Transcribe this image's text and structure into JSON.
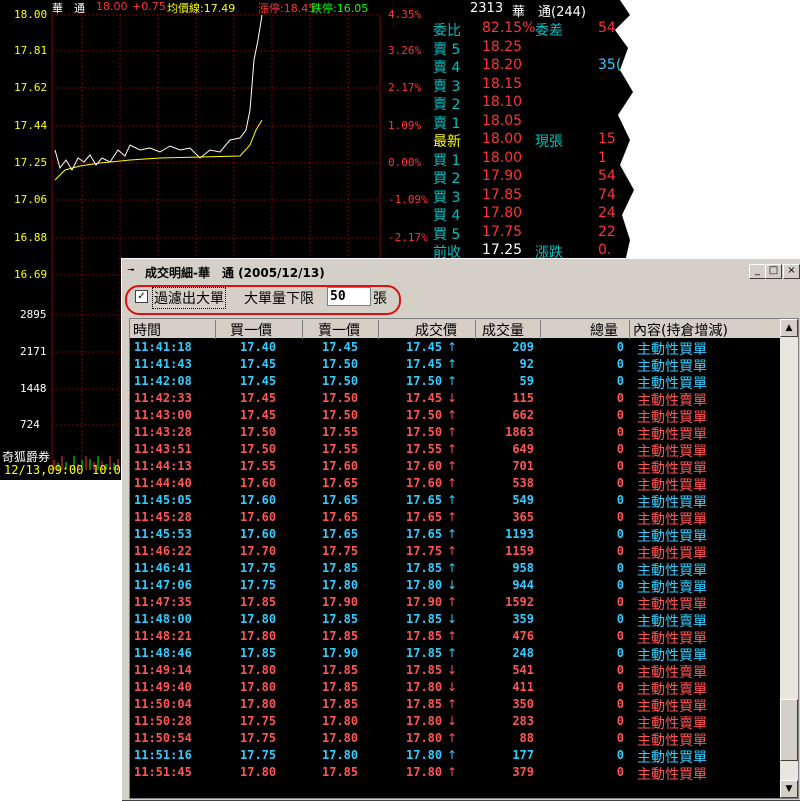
{
  "chart": {
    "header": {
      "name": "華　通",
      "price": "18.00",
      "change": "+0.75",
      "avg": "均價線:17.49",
      "limit_up": "漲停:18.45",
      "limit_down": "跌停:16.05"
    },
    "price_axis": [
      "18.00",
      "17.81",
      "17.62",
      "17.44",
      "17.25",
      "17.06",
      "16.88",
      "16.69"
    ],
    "pct_axis": [
      "4.35%",
      "3.26%",
      "2.17%",
      "1.09%",
      "0.00%",
      "-1.09%",
      "-2.17%"
    ],
    "volume_axis": [
      "2895",
      "2171",
      "1448",
      "724"
    ],
    "broker": "奇狐爵券",
    "time_start": "12/13,09:00",
    "time_next": "10:0"
  },
  "quote": {
    "code": "2313",
    "name": "華　通(244)",
    "rows": [
      {
        "label": "委比",
        "value": "82.15%",
        "label2": "委差",
        "value2": "54"
      },
      {
        "label": "賣 5",
        "value": "18.25",
        "value2": ""
      },
      {
        "label": "賣 4",
        "value": "18.20",
        "value2": "35("
      },
      {
        "label": "賣 3",
        "value": "18.15",
        "value2": ""
      },
      {
        "label": "賣 2",
        "value": "18.10",
        "value2": ""
      },
      {
        "label": "賣 1",
        "value": "18.05",
        "value2": ""
      },
      {
        "label": "最新",
        "value": "18.00",
        "label2": "現張",
        "value2": "15"
      },
      {
        "label": "買 1",
        "value": "18.00",
        "value2": "1"
      },
      {
        "label": "買 2",
        "value": "17.90",
        "value2": "54"
      },
      {
        "label": "買 3",
        "value": "17.85",
        "value2": "74"
      },
      {
        "label": "買 4",
        "value": "17.80",
        "value2": "24"
      },
      {
        "label": "買 5",
        "value": "17.75",
        "value2": "22"
      },
      {
        "label": "前收",
        "value": "17.25",
        "label2": "漲跌",
        "value2": "0."
      }
    ]
  },
  "window": {
    "title": "成交明細-華　通 (2005/12/13)",
    "filter_checked": "✓",
    "filter_label": "過濾出大單",
    "min_label": "大單量下限",
    "min_value": "50",
    "unit": "張",
    "columns": [
      "時間",
      "買一價",
      "賣一價",
      "成交價",
      "成交量",
      "總量",
      "內容(持倉增減)"
    ],
    "rows": [
      {
        "time": "11:41:18",
        "bid": "17.40",
        "ask": "17.45",
        "price": "17.45",
        "dir": "↑",
        "vol": "209",
        "total": "0",
        "note": "主動性買單",
        "side": "buy"
      },
      {
        "time": "11:41:43",
        "bid": "17.45",
        "ask": "17.50",
        "price": "17.45",
        "dir": "↑",
        "vol": "92",
        "total": "0",
        "note": "主動性買單",
        "side": "buy"
      },
      {
        "time": "11:42:08",
        "bid": "17.45",
        "ask": "17.50",
        "price": "17.50",
        "dir": "↑",
        "vol": "59",
        "total": "0",
        "note": "主動性買單",
        "side": "buy"
      },
      {
        "time": "11:42:33",
        "bid": "17.45",
        "ask": "17.50",
        "price": "17.45",
        "dir": "↓",
        "vol": "115",
        "total": "0",
        "note": "主動性賣單",
        "side": "sell"
      },
      {
        "time": "11:43:00",
        "bid": "17.45",
        "ask": "17.50",
        "price": "17.50",
        "dir": "↑",
        "vol": "662",
        "total": "0",
        "note": "主動性買單",
        "side": "sell"
      },
      {
        "time": "11:43:28",
        "bid": "17.50",
        "ask": "17.55",
        "price": "17.50",
        "dir": "↑",
        "vol": "1863",
        "total": "0",
        "note": "主動性買單",
        "side": "sell"
      },
      {
        "time": "11:43:51",
        "bid": "17.50",
        "ask": "17.55",
        "price": "17.55",
        "dir": "↑",
        "vol": "649",
        "total": "0",
        "note": "主動性買單",
        "side": "sell"
      },
      {
        "time": "11:44:13",
        "bid": "17.55",
        "ask": "17.60",
        "price": "17.60",
        "dir": "↑",
        "vol": "701",
        "total": "0",
        "note": "主動性買單",
        "side": "sell"
      },
      {
        "time": "11:44:40",
        "bid": "17.60",
        "ask": "17.65",
        "price": "17.60",
        "dir": "↑",
        "vol": "538",
        "total": "0",
        "note": "主動性買單",
        "side": "sell"
      },
      {
        "time": "11:45:05",
        "bid": "17.60",
        "ask": "17.65",
        "price": "17.65",
        "dir": "↑",
        "vol": "549",
        "total": "0",
        "note": "主動性買單",
        "side": "buy"
      },
      {
        "time": "11:45:28",
        "bid": "17.60",
        "ask": "17.65",
        "price": "17.65",
        "dir": "↑",
        "vol": "365",
        "total": "0",
        "note": "主動性買單",
        "side": "sell"
      },
      {
        "time": "11:45:53",
        "bid": "17.60",
        "ask": "17.65",
        "price": "17.65",
        "dir": "↑",
        "vol": "1193",
        "total": "0",
        "note": "主動性買單",
        "side": "buy"
      },
      {
        "time": "11:46:22",
        "bid": "17.70",
        "ask": "17.75",
        "price": "17.75",
        "dir": "↑",
        "vol": "1159",
        "total": "0",
        "note": "主動性買單",
        "side": "sell"
      },
      {
        "time": "11:46:41",
        "bid": "17.75",
        "ask": "17.85",
        "price": "17.85",
        "dir": "↑",
        "vol": "958",
        "total": "0",
        "note": "主動性買單",
        "side": "buy"
      },
      {
        "time": "11:47:06",
        "bid": "17.75",
        "ask": "17.80",
        "price": "17.80",
        "dir": "↓",
        "vol": "944",
        "total": "0",
        "note": "主動性賣單",
        "side": "buy"
      },
      {
        "time": "11:47:35",
        "bid": "17.85",
        "ask": "17.90",
        "price": "17.90",
        "dir": "↑",
        "vol": "1592",
        "total": "0",
        "note": "主動性買單",
        "side": "sell"
      },
      {
        "time": "11:48:00",
        "bid": "17.80",
        "ask": "17.85",
        "price": "17.85",
        "dir": "↓",
        "vol": "359",
        "total": "0",
        "note": "主動性賣單",
        "side": "buy"
      },
      {
        "time": "11:48:21",
        "bid": "17.80",
        "ask": "17.85",
        "price": "17.85",
        "dir": "↑",
        "vol": "476",
        "total": "0",
        "note": "主動性買單",
        "side": "sell"
      },
      {
        "time": "11:48:46",
        "bid": "17.85",
        "ask": "17.90",
        "price": "17.85",
        "dir": "↑",
        "vol": "248",
        "total": "0",
        "note": "主動性買單",
        "side": "buy"
      },
      {
        "time": "11:49:14",
        "bid": "17.80",
        "ask": "17.85",
        "price": "17.85",
        "dir": "↓",
        "vol": "541",
        "total": "0",
        "note": "主動性賣單",
        "side": "sell"
      },
      {
        "time": "11:49:40",
        "bid": "17.80",
        "ask": "17.85",
        "price": "17.80",
        "dir": "↓",
        "vol": "411",
        "total": "0",
        "note": "主動性賣單",
        "side": "sell"
      },
      {
        "time": "11:50:04",
        "bid": "17.80",
        "ask": "17.85",
        "price": "17.85",
        "dir": "↑",
        "vol": "350",
        "total": "0",
        "note": "主動性買單",
        "side": "sell"
      },
      {
        "time": "11:50:28",
        "bid": "17.75",
        "ask": "17.80",
        "price": "17.80",
        "dir": "↓",
        "vol": "283",
        "total": "0",
        "note": "主動性賣單",
        "side": "sell"
      },
      {
        "time": "11:50:54",
        "bid": "17.75",
        "ask": "17.80",
        "price": "17.80",
        "dir": "↑",
        "vol": "88",
        "total": "0",
        "note": "主動性買單",
        "side": "sell"
      },
      {
        "time": "11:51:16",
        "bid": "17.75",
        "ask": "17.80",
        "price": "17.80",
        "dir": "↑",
        "vol": "177",
        "total": "0",
        "note": "主動性買單",
        "side": "buy"
      },
      {
        "time": "11:51:45",
        "bid": "17.80",
        "ask": "17.85",
        "price": "17.80",
        "dir": "↑",
        "vol": "379",
        "total": "0",
        "note": "主動性買單",
        "side": "sell"
      }
    ]
  },
  "colors": {
    "buy": "#33ccff",
    "sell": "#ff5555",
    "label_cyan": "#00c0c0",
    "price_red": "#ff3333"
  }
}
